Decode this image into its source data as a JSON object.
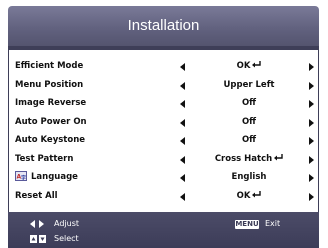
{
  "window": {
    "title": "Installation"
  },
  "menu": {
    "rows": [
      {
        "label": "Efficient Mode",
        "value": "OK",
        "value_suffix_icon": "enter-arrow-icon"
      },
      {
        "label": "Menu Position",
        "value": "Upper Left"
      },
      {
        "label": "Image Reverse",
        "value": "Off"
      },
      {
        "label": "Auto Power On",
        "value": "Off"
      },
      {
        "label": "Auto Keystone",
        "value": "Off"
      },
      {
        "label": "Test Pattern",
        "value": "Cross Hatch",
        "value_suffix_icon": "enter-arrow-icon"
      },
      {
        "label": "Language",
        "value": "English",
        "label_prefix_icon": "language-icon"
      },
      {
        "label": "Reset All",
        "value": "OK",
        "value_suffix_icon": "enter-arrow-icon"
      }
    ]
  },
  "footer": {
    "adjust_label": "Adjust",
    "select_label": "Select",
    "menu_badge": "MENU",
    "exit_label": "Exit"
  },
  "colors": {
    "header_bg": "#62627f",
    "footer_bg": "#3c3c58",
    "frame_border": "#3e3e58",
    "text": "#111111"
  }
}
